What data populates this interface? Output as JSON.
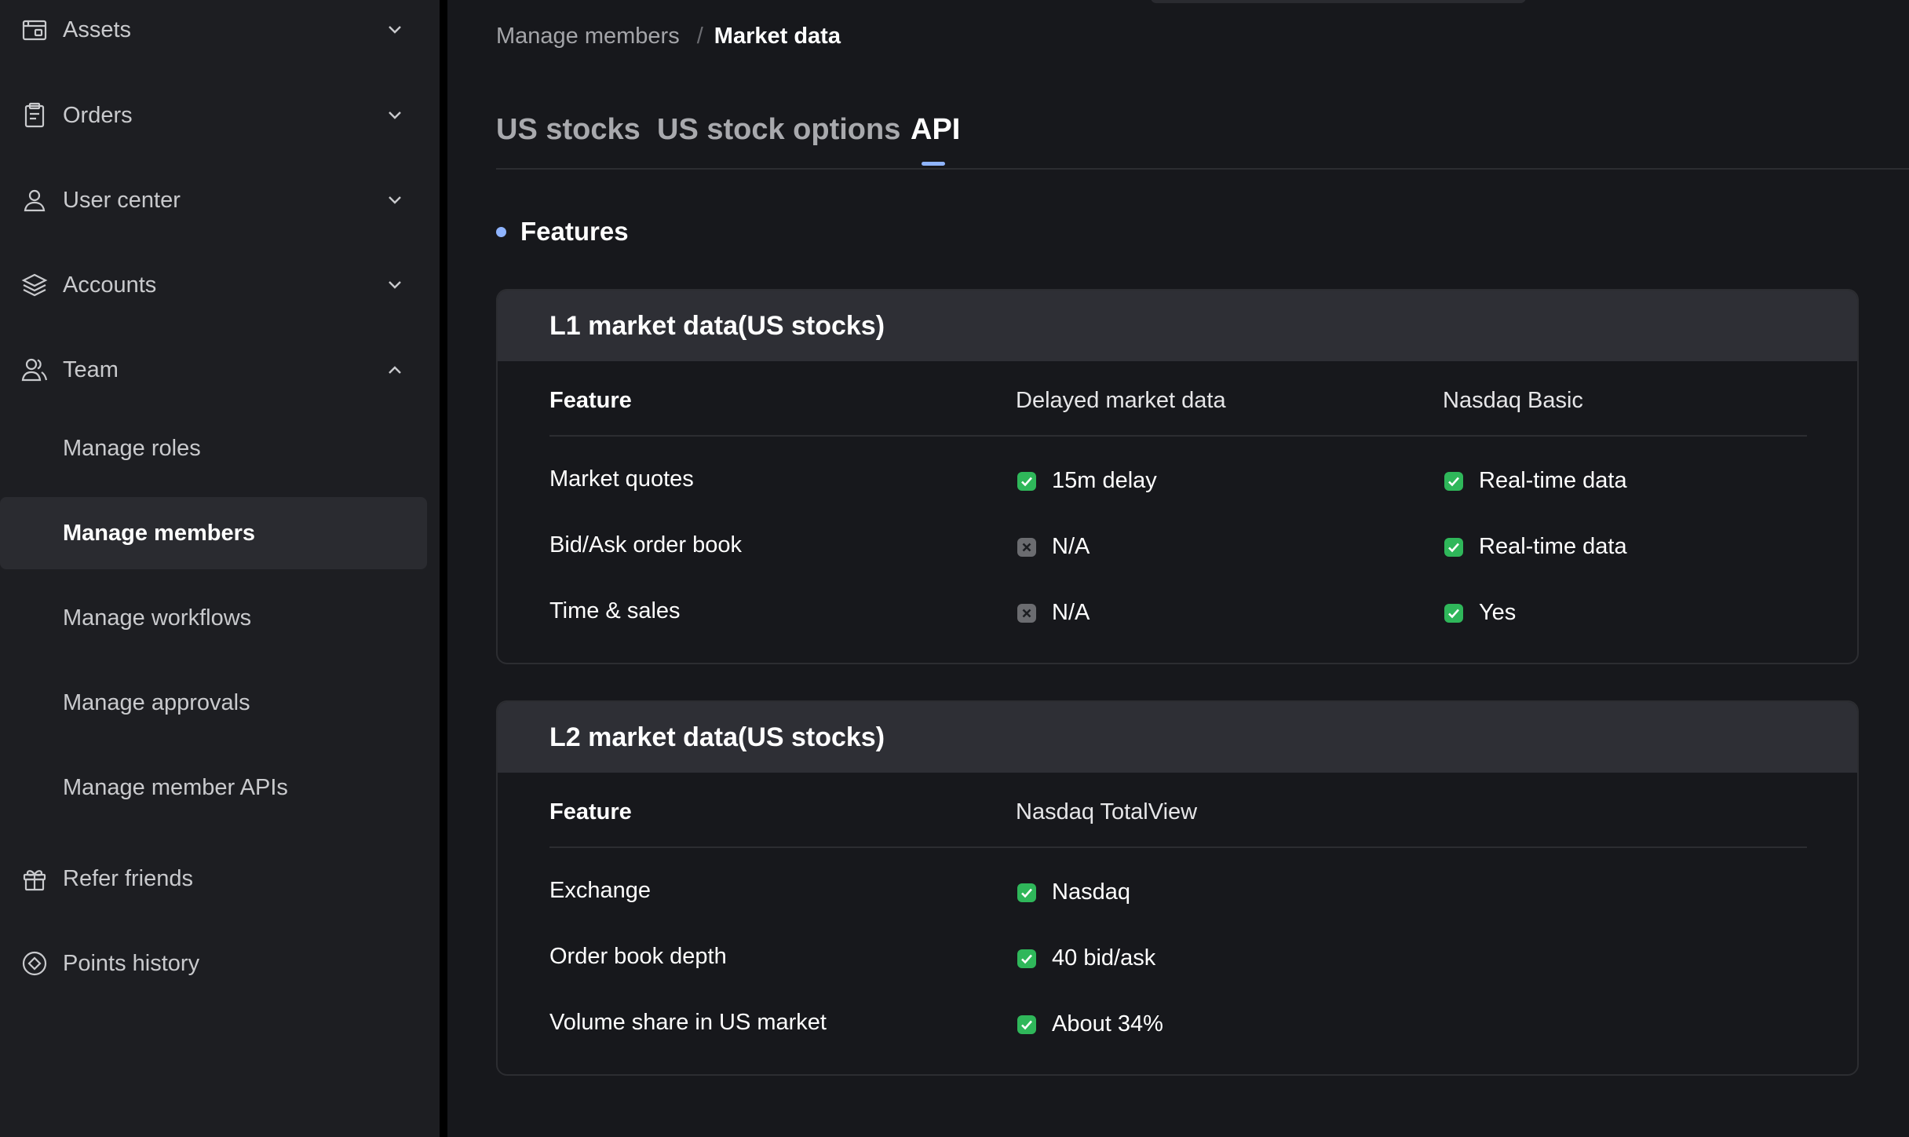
{
  "sidebar": {
    "items": [
      {
        "label": "Assets",
        "icon": "folder-icon",
        "expanded": false
      },
      {
        "label": "Orders",
        "icon": "clipboard-icon",
        "expanded": false
      },
      {
        "label": "User center",
        "icon": "user-icon",
        "expanded": false
      },
      {
        "label": "Accounts",
        "icon": "layers-icon",
        "expanded": false
      },
      {
        "label": "Team",
        "icon": "team-icon",
        "expanded": true
      },
      {
        "label": "Refer friends",
        "icon": "gift-icon"
      },
      {
        "label": "Points history",
        "icon": "points-icon"
      }
    ],
    "team_subitems": [
      {
        "label": "Manage roles"
      },
      {
        "label": "Manage members",
        "active": true
      },
      {
        "label": "Manage workflows"
      },
      {
        "label": "Manage approvals"
      },
      {
        "label": "Manage member APIs"
      }
    ]
  },
  "breadcrumb": {
    "parent": "Manage members",
    "separator": "/",
    "current": "Market data"
  },
  "tabs": [
    {
      "label": "US stocks",
      "active": false
    },
    {
      "label": "US stock options",
      "active": false
    },
    {
      "label": "API",
      "active": true
    }
  ],
  "section": {
    "title": "Features"
  },
  "cards": [
    {
      "title": "L1 market data(US stocks)",
      "columns": [
        "Feature",
        "Delayed market data",
        "Nasdaq Basic"
      ],
      "rows": [
        {
          "feature": "Market quotes",
          "cells": [
            {
              "text": "15m delay",
              "status": "check"
            },
            {
              "text": "Real-time data",
              "status": "check"
            }
          ]
        },
        {
          "feature": "Bid/Ask order book",
          "cells": [
            {
              "text": "N/A",
              "status": "cross"
            },
            {
              "text": "Real-time data",
              "status": "check"
            }
          ]
        },
        {
          "feature": "Time & sales",
          "cells": [
            {
              "text": "N/A",
              "status": "cross"
            },
            {
              "text": "Yes",
              "status": "check"
            }
          ]
        }
      ]
    },
    {
      "title": "L2 market data(US stocks)",
      "columns": [
        "Feature",
        "Nasdaq TotalView"
      ],
      "rows": [
        {
          "feature": "Exchange",
          "cells": [
            {
              "text": "Nasdaq",
              "status": "check"
            }
          ]
        },
        {
          "feature": "Order book depth",
          "cells": [
            {
              "text": "40 bid/ask",
              "status": "check"
            }
          ]
        },
        {
          "feature": "Volume share in US market",
          "cells": [
            {
              "text": "About 34%",
              "status": "check"
            }
          ]
        }
      ]
    }
  ],
  "colors": {
    "accent": "#8fb4ff",
    "check": "#2fb75a",
    "cross": "#6b6c70",
    "active_nav_bg": "#2a2b30"
  }
}
